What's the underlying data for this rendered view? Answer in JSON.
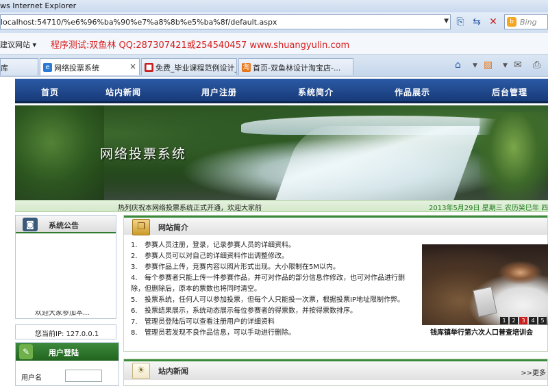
{
  "browser": {
    "window_title": "ws Internet Explorer",
    "url": "localhost:54710/%e6%96%ba%90%e7%a8%8b%e5%ba%8f/default.aspx",
    "search_placeholder": "Bing",
    "suggested_sites": "建议网站",
    "promo_text": "程序测试:双鱼林 QQ:287307421或254540457 www.shuangyulin.com",
    "tabs": [
      {
        "label": "库",
        "icon": "ie-icon",
        "active": false
      },
      {
        "label": "网络投票系统",
        "icon": "ie-icon",
        "active": true
      },
      {
        "label": "免费_毕业课程范例设计_...",
        "icon": "page-icon",
        "active": false
      },
      {
        "label": "首页-双鱼林设计淘宝店-...",
        "icon": "taobao-icon",
        "active": false
      }
    ]
  },
  "nav": {
    "items": [
      "首页",
      "站内新闻",
      "用户注册",
      "系统简介",
      "作品展示",
      "后台管理"
    ]
  },
  "banner": {
    "title": "网络投票系统"
  },
  "ticker": {
    "message": "热列庆祝本网络投票系统正式开通，欢迎大家前",
    "date": "2013年5月29日 星期三 农历癸巳年 四月"
  },
  "announce": {
    "title": "系统公告",
    "scroll_text": "欢迎大家参加本..."
  },
  "ip": {
    "text": "您当前IP: 127.0.0.1"
  },
  "login": {
    "title": "用户登陆",
    "username_label": "用户名",
    "username_value": ""
  },
  "intro": {
    "title": "网站简介",
    "items": [
      "参赛人员注册，登录，记录参赛人员的详细资料。",
      "参赛人员可以对自己的详细资料作出调整修改。",
      "参赛作品上传，竞赛内容以照片形式出现。大小限制在5M以内。",
      "每个参赛者只能上传一件参赛作品，并可对作品的部分信息作修改，也可对作品进行删除，但删除后，原本的票数也将同时清空。",
      "投票系统，任何人可以参加投票，但每个人只能投一次票，根据投票IP地址限制作弊。",
      "投票结果展示，系统动态展示每位参赛者的得票数，并按得票数排序。",
      "管理员登陆后可以查看注册用户的详细资料",
      "管理员若发现不良作品信息，可以手动进行删除。"
    ]
  },
  "photo": {
    "caption": "钱库镇举行第六次人口普查培训会",
    "slides": [
      "1",
      "2",
      "3",
      "4",
      "5"
    ],
    "active_slide": 3
  },
  "news": {
    "title": "站内新闻",
    "more": ">>更多"
  }
}
